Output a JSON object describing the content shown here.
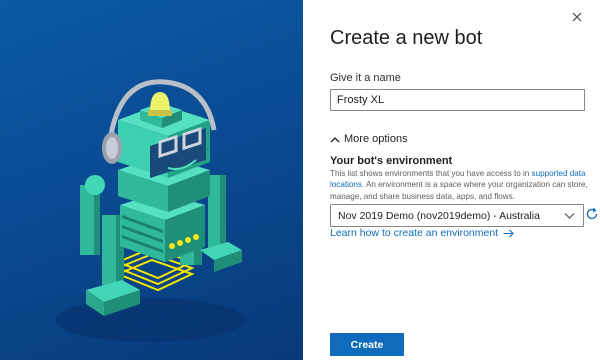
{
  "dialog": {
    "title": "Create a new bot",
    "close_icon": "close-icon"
  },
  "name_field": {
    "label": "Give it a name",
    "value": "Frosty XL"
  },
  "more_options": {
    "label": "More options",
    "icon": "chevron-up-icon"
  },
  "environment": {
    "heading": "Your bot's environment",
    "description_before": "This list shows environments that you have access to in ",
    "description_link": "supported data locations",
    "description_after": ". An environment is a space where your organization can store, manage, and share business data, apps, and flows.",
    "selected": "Nov 2019 Demo (nov2019demo) - Australia",
    "refresh_icon": "refresh-icon",
    "learn_link": "Learn how to create an environment",
    "learn_icon": "arrow-right-icon"
  },
  "actions": {
    "create_label": "Create"
  },
  "colors": {
    "accent": "#0f6cbd",
    "panel_blue": "#0a4b93",
    "robot_teal": "#3ccfb0"
  }
}
